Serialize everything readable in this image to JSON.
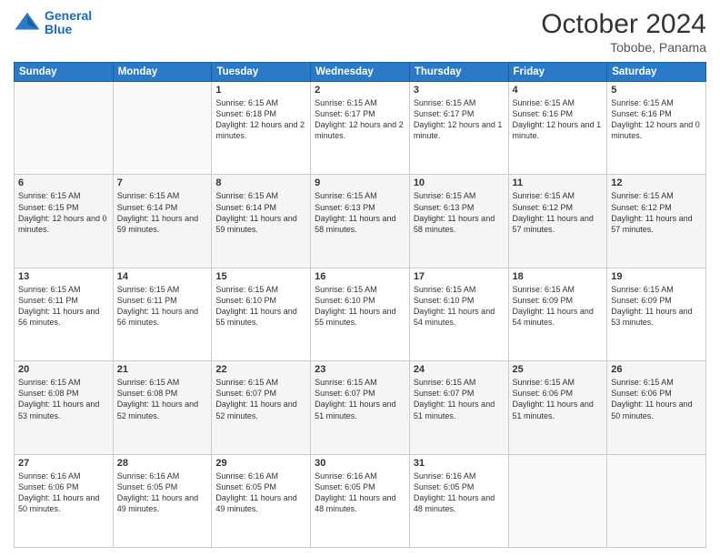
{
  "header": {
    "logo_line1": "General",
    "logo_line2": "Blue",
    "month": "October 2024",
    "location": "Tobobe, Panama"
  },
  "days_of_week": [
    "Sunday",
    "Monday",
    "Tuesday",
    "Wednesday",
    "Thursday",
    "Friday",
    "Saturday"
  ],
  "weeks": [
    [
      {
        "day": "",
        "sunrise": "",
        "sunset": "",
        "daylight": ""
      },
      {
        "day": "",
        "sunrise": "",
        "sunset": "",
        "daylight": ""
      },
      {
        "day": "1",
        "sunrise": "Sunrise: 6:15 AM",
        "sunset": "Sunset: 6:18 PM",
        "daylight": "Daylight: 12 hours and 2 minutes."
      },
      {
        "day": "2",
        "sunrise": "Sunrise: 6:15 AM",
        "sunset": "Sunset: 6:17 PM",
        "daylight": "Daylight: 12 hours and 2 minutes."
      },
      {
        "day": "3",
        "sunrise": "Sunrise: 6:15 AM",
        "sunset": "Sunset: 6:17 PM",
        "daylight": "Daylight: 12 hours and 1 minute."
      },
      {
        "day": "4",
        "sunrise": "Sunrise: 6:15 AM",
        "sunset": "Sunset: 6:16 PM",
        "daylight": "Daylight: 12 hours and 1 minute."
      },
      {
        "day": "5",
        "sunrise": "Sunrise: 6:15 AM",
        "sunset": "Sunset: 6:16 PM",
        "daylight": "Daylight: 12 hours and 0 minutes."
      }
    ],
    [
      {
        "day": "6",
        "sunrise": "Sunrise: 6:15 AM",
        "sunset": "Sunset: 6:15 PM",
        "daylight": "Daylight: 12 hours and 0 minutes."
      },
      {
        "day": "7",
        "sunrise": "Sunrise: 6:15 AM",
        "sunset": "Sunset: 6:14 PM",
        "daylight": "Daylight: 11 hours and 59 minutes."
      },
      {
        "day": "8",
        "sunrise": "Sunrise: 6:15 AM",
        "sunset": "Sunset: 6:14 PM",
        "daylight": "Daylight: 11 hours and 59 minutes."
      },
      {
        "day": "9",
        "sunrise": "Sunrise: 6:15 AM",
        "sunset": "Sunset: 6:13 PM",
        "daylight": "Daylight: 11 hours and 58 minutes."
      },
      {
        "day": "10",
        "sunrise": "Sunrise: 6:15 AM",
        "sunset": "Sunset: 6:13 PM",
        "daylight": "Daylight: 11 hours and 58 minutes."
      },
      {
        "day": "11",
        "sunrise": "Sunrise: 6:15 AM",
        "sunset": "Sunset: 6:12 PM",
        "daylight": "Daylight: 11 hours and 57 minutes."
      },
      {
        "day": "12",
        "sunrise": "Sunrise: 6:15 AM",
        "sunset": "Sunset: 6:12 PM",
        "daylight": "Daylight: 11 hours and 57 minutes."
      }
    ],
    [
      {
        "day": "13",
        "sunrise": "Sunrise: 6:15 AM",
        "sunset": "Sunset: 6:11 PM",
        "daylight": "Daylight: 11 hours and 56 minutes."
      },
      {
        "day": "14",
        "sunrise": "Sunrise: 6:15 AM",
        "sunset": "Sunset: 6:11 PM",
        "daylight": "Daylight: 11 hours and 56 minutes."
      },
      {
        "day": "15",
        "sunrise": "Sunrise: 6:15 AM",
        "sunset": "Sunset: 6:10 PM",
        "daylight": "Daylight: 11 hours and 55 minutes."
      },
      {
        "day": "16",
        "sunrise": "Sunrise: 6:15 AM",
        "sunset": "Sunset: 6:10 PM",
        "daylight": "Daylight: 11 hours and 55 minutes."
      },
      {
        "day": "17",
        "sunrise": "Sunrise: 6:15 AM",
        "sunset": "Sunset: 6:10 PM",
        "daylight": "Daylight: 11 hours and 54 minutes."
      },
      {
        "day": "18",
        "sunrise": "Sunrise: 6:15 AM",
        "sunset": "Sunset: 6:09 PM",
        "daylight": "Daylight: 11 hours and 54 minutes."
      },
      {
        "day": "19",
        "sunrise": "Sunrise: 6:15 AM",
        "sunset": "Sunset: 6:09 PM",
        "daylight": "Daylight: 11 hours and 53 minutes."
      }
    ],
    [
      {
        "day": "20",
        "sunrise": "Sunrise: 6:15 AM",
        "sunset": "Sunset: 6:08 PM",
        "daylight": "Daylight: 11 hours and 53 minutes."
      },
      {
        "day": "21",
        "sunrise": "Sunrise: 6:15 AM",
        "sunset": "Sunset: 6:08 PM",
        "daylight": "Daylight: 11 hours and 52 minutes."
      },
      {
        "day": "22",
        "sunrise": "Sunrise: 6:15 AM",
        "sunset": "Sunset: 6:07 PM",
        "daylight": "Daylight: 11 hours and 52 minutes."
      },
      {
        "day": "23",
        "sunrise": "Sunrise: 6:15 AM",
        "sunset": "Sunset: 6:07 PM",
        "daylight": "Daylight: 11 hours and 51 minutes."
      },
      {
        "day": "24",
        "sunrise": "Sunrise: 6:15 AM",
        "sunset": "Sunset: 6:07 PM",
        "daylight": "Daylight: 11 hours and 51 minutes."
      },
      {
        "day": "25",
        "sunrise": "Sunrise: 6:15 AM",
        "sunset": "Sunset: 6:06 PM",
        "daylight": "Daylight: 11 hours and 51 minutes."
      },
      {
        "day": "26",
        "sunrise": "Sunrise: 6:15 AM",
        "sunset": "Sunset: 6:06 PM",
        "daylight": "Daylight: 11 hours and 50 minutes."
      }
    ],
    [
      {
        "day": "27",
        "sunrise": "Sunrise: 6:16 AM",
        "sunset": "Sunset: 6:06 PM",
        "daylight": "Daylight: 11 hours and 50 minutes."
      },
      {
        "day": "28",
        "sunrise": "Sunrise: 6:16 AM",
        "sunset": "Sunset: 6:05 PM",
        "daylight": "Daylight: 11 hours and 49 minutes."
      },
      {
        "day": "29",
        "sunrise": "Sunrise: 6:16 AM",
        "sunset": "Sunset: 6:05 PM",
        "daylight": "Daylight: 11 hours and 49 minutes."
      },
      {
        "day": "30",
        "sunrise": "Sunrise: 6:16 AM",
        "sunset": "Sunset: 6:05 PM",
        "daylight": "Daylight: 11 hours and 48 minutes."
      },
      {
        "day": "31",
        "sunrise": "Sunrise: 6:16 AM",
        "sunset": "Sunset: 6:05 PM",
        "daylight": "Daylight: 11 hours and 48 minutes."
      },
      {
        "day": "",
        "sunrise": "",
        "sunset": "",
        "daylight": ""
      },
      {
        "day": "",
        "sunrise": "",
        "sunset": "",
        "daylight": ""
      }
    ]
  ]
}
